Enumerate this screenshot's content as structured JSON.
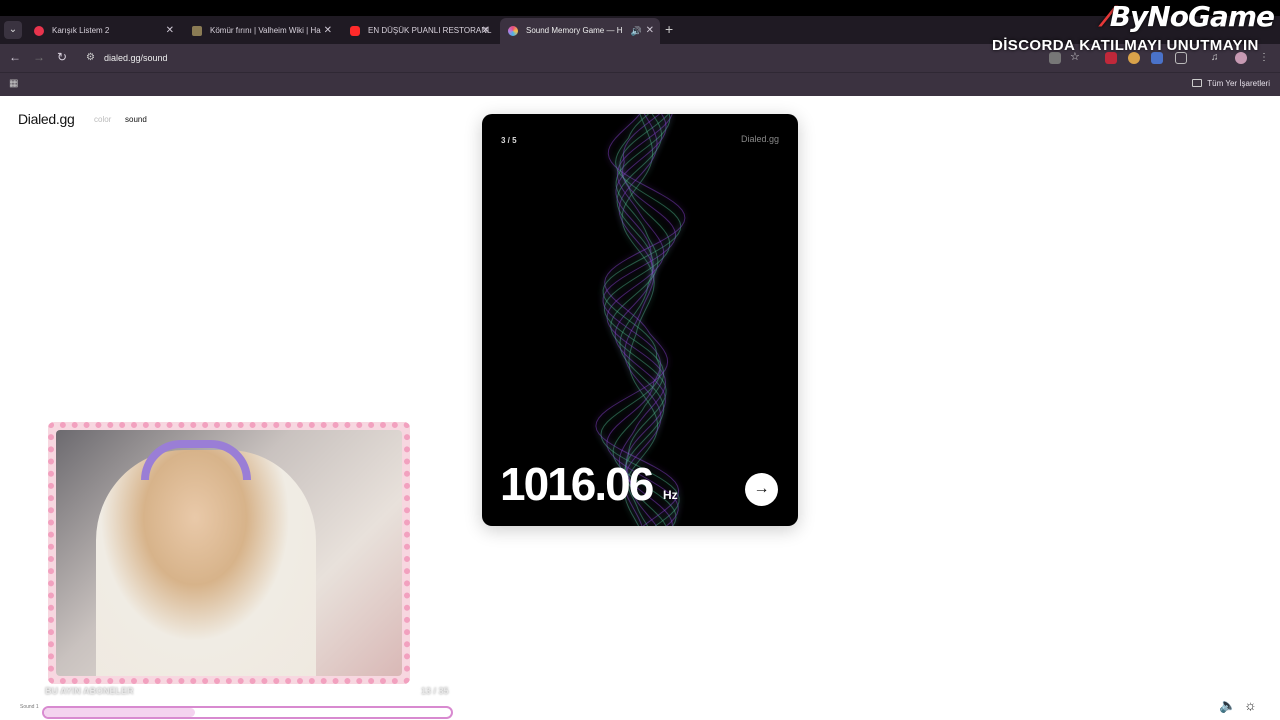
{
  "browser": {
    "tabs": [
      {
        "title": "Karışık Listem 2",
        "favicon_color": "#e8344d"
      },
      {
        "title": "Kömür fırını | Valheim Wiki | Ha",
        "favicon_color": "#8a7b54"
      },
      {
        "title": "EN DÜŞÜK PUANLI RESTORANL",
        "favicon_color": "#ff2a2a"
      },
      {
        "title": "Sound Memory Game — H",
        "favicon_color": "#b57be0"
      }
    ],
    "url": "dialed.gg/sound",
    "bookmarks_all": "Tüm Yer İşaretleri"
  },
  "overlay": {
    "brand": "ByNoGame",
    "notice": "DİSCORDA KATILMAYI UNUTMAYIN"
  },
  "site": {
    "logo": "Dialed.gg",
    "nav": {
      "color": "color",
      "sound": "sound"
    }
  },
  "card": {
    "counter": "3 / 5",
    "brand": "Dialed.gg",
    "frequency": "1016.06",
    "unit": "Hz"
  },
  "stream": {
    "caption": "BU AYIN ABONELER",
    "count": "13 / 35",
    "progress_label": "Sound 1",
    "progress_fraction": 0.37
  },
  "colors": {
    "chrome": "#3b3240",
    "wave_purple": "#8b45d6",
    "wave_green": "#4fb58f"
  }
}
